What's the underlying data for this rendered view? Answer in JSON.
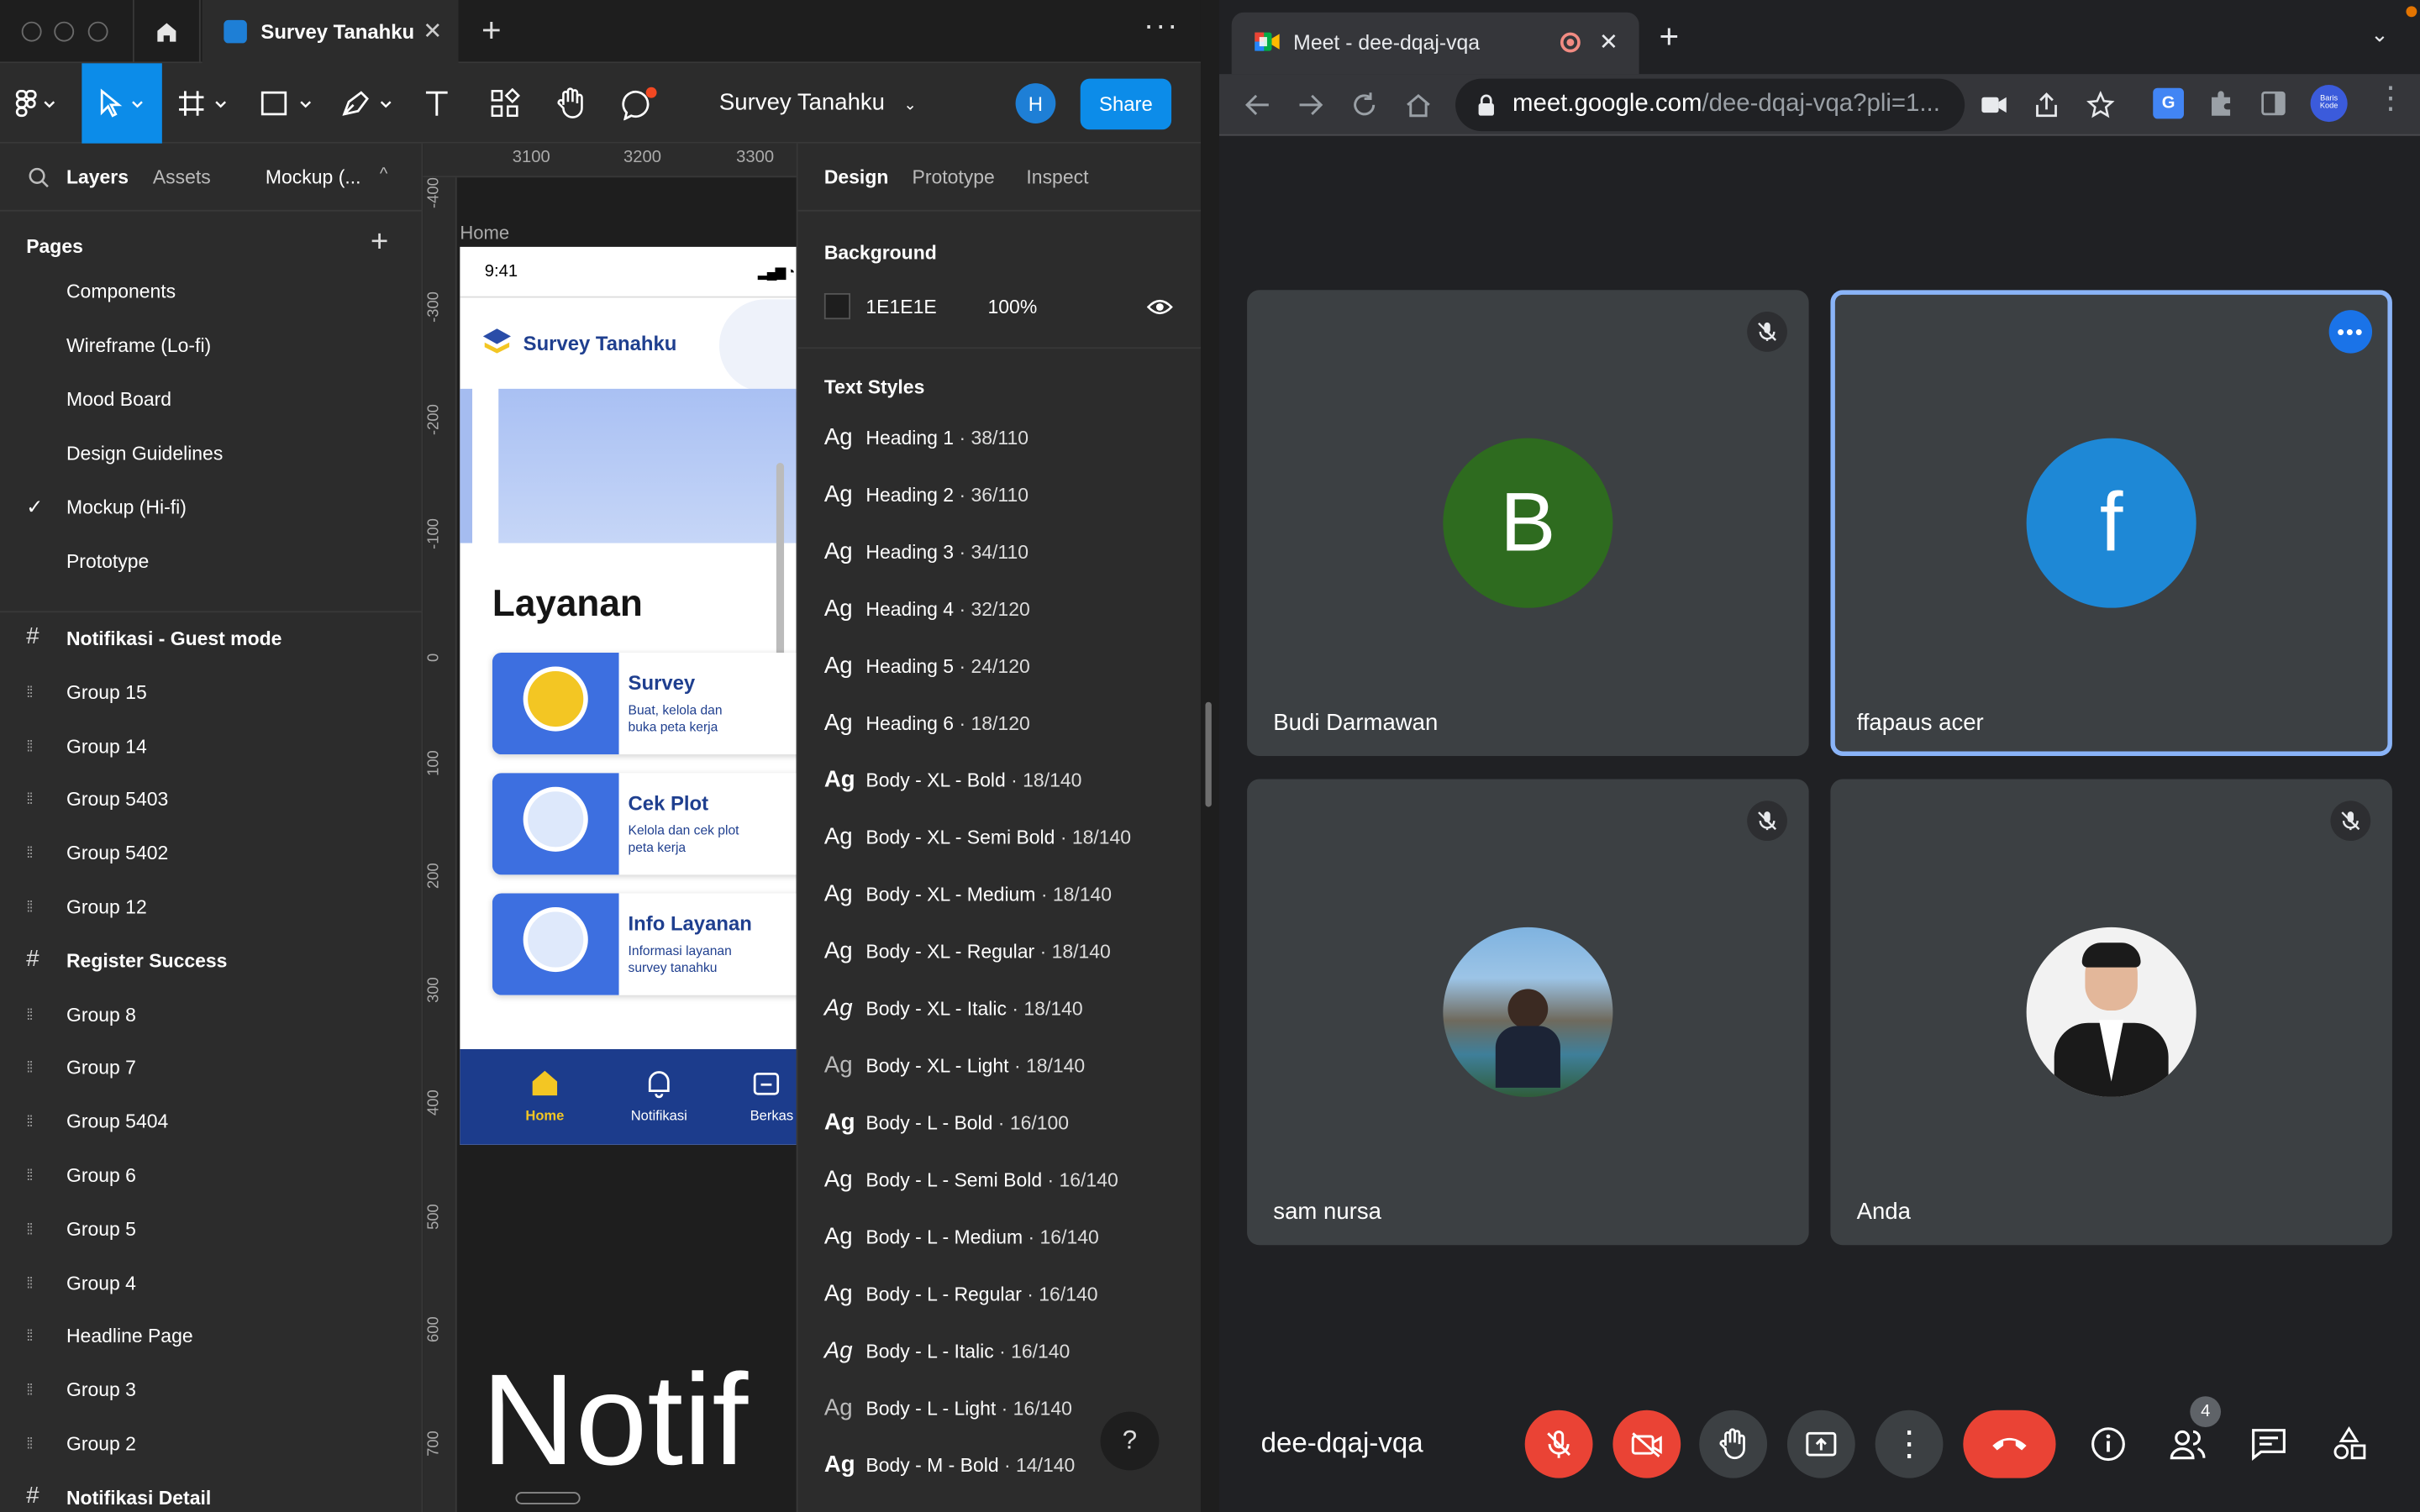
{
  "figma": {
    "tab_title": "Survey Tanahku",
    "file_title": "Survey Tanahku",
    "avatar_letter": "H",
    "share_label": "Share",
    "left_tabs": {
      "layers": "Layers",
      "assets": "Assets",
      "page": "Mockup (..."
    },
    "pages_header": "Pages",
    "pages": [
      {
        "label": "Components"
      },
      {
        "label": "Wireframe (Lo-fi)"
      },
      {
        "label": "Mood Board"
      },
      {
        "label": "Design Guidelines"
      },
      {
        "label": "Mockup (Hi-fi)",
        "selected": true
      },
      {
        "label": "Prototype"
      }
    ],
    "layers": [
      {
        "label": "Notifikasi - Guest mode",
        "kind": "frame"
      },
      {
        "label": "Group 15",
        "kind": "group"
      },
      {
        "label": "Group 14",
        "kind": "group"
      },
      {
        "label": "Group 5403",
        "kind": "group"
      },
      {
        "label": "Group 5402",
        "kind": "group"
      },
      {
        "label": "Group 12",
        "kind": "group"
      },
      {
        "label": "Register Success",
        "kind": "frame"
      },
      {
        "label": "Group 8",
        "kind": "group"
      },
      {
        "label": "Group 7",
        "kind": "group"
      },
      {
        "label": "Group 5404",
        "kind": "group"
      },
      {
        "label": "Group 6",
        "kind": "group"
      },
      {
        "label": "Group 5",
        "kind": "group"
      },
      {
        "label": "Group 4",
        "kind": "group"
      },
      {
        "label": "Headline Page",
        "kind": "group"
      },
      {
        "label": "Group 3",
        "kind": "group"
      },
      {
        "label": "Group 2",
        "kind": "group"
      },
      {
        "label": "Notifikasi Detail",
        "kind": "frame"
      }
    ],
    "ruler_top": [
      "3100",
      "3200",
      "3300"
    ],
    "ruler_left": [
      "-400",
      "-300",
      "-200",
      "-100",
      "0",
      "100",
      "200",
      "300",
      "400",
      "500",
      "600",
      "700"
    ],
    "canvas": {
      "frame_label": "Home",
      "status_time": "9:41",
      "app_name": "Survey Tanahku",
      "section_title": "Layanan",
      "cards": [
        {
          "title": "Survey",
          "desc": "Buat, kelola dan buka peta kerja"
        },
        {
          "title": "Cek Plot",
          "desc": "Kelola dan cek plot peta kerja"
        },
        {
          "title": "Info Layanan",
          "desc": "Informasi layanan survey tanahku"
        }
      ],
      "nav": [
        {
          "label": "Home"
        },
        {
          "label": "Notifikasi"
        },
        {
          "label": "Berkas"
        }
      ],
      "big_text": "Notif"
    },
    "right_tabs": {
      "design": "Design",
      "prototype": "Prototype",
      "inspect": "Inspect"
    },
    "background": {
      "title": "Background",
      "hex": "1E1E1E",
      "opacity": "100%",
      "color": "#1e1e1e"
    },
    "text_styles_title": "Text Styles",
    "text_styles": [
      {
        "name": "Heading 1",
        "spec": " · 38/110",
        "style": "normal",
        "weight": "normal"
      },
      {
        "name": "Heading 2",
        "spec": " · 36/110",
        "style": "normal",
        "weight": "normal"
      },
      {
        "name": "Heading 3",
        "spec": " · 34/110",
        "style": "normal",
        "weight": "normal"
      },
      {
        "name": "Heading 4",
        "spec": " · 32/120",
        "style": "normal",
        "weight": "normal"
      },
      {
        "name": "Heading 5",
        "spec": " · 24/120",
        "style": "normal",
        "weight": "normal"
      },
      {
        "name": "Heading 6",
        "spec": " · 18/120",
        "style": "normal",
        "weight": "normal"
      },
      {
        "name": "Body - XL - Bold",
        "spec": " · 18/140",
        "style": "normal",
        "weight": "bold"
      },
      {
        "name": "Body - XL - Semi Bold",
        "spec": " · 18/140",
        "style": "normal",
        "weight": "normal"
      },
      {
        "name": "Body - XL - Medium",
        "spec": " · 18/140",
        "style": "normal",
        "weight": "normal"
      },
      {
        "name": "Body - XL - Regular",
        "spec": " · 18/140",
        "style": "normal",
        "weight": "normal"
      },
      {
        "name": "Body - XL - Italic",
        "spec": " · 18/140",
        "style": "italic",
        "weight": "normal"
      },
      {
        "name": "Body - XL - Light",
        "spec": " · 18/140",
        "style": "normal",
        "weight": "light"
      },
      {
        "name": "Body - L - Bold",
        "spec": " · 16/100",
        "style": "normal",
        "weight": "bold"
      },
      {
        "name": "Body - L - Semi Bold",
        "spec": " · 16/140",
        "style": "normal",
        "weight": "normal"
      },
      {
        "name": "Body - L - Medium",
        "spec": " · 16/140",
        "style": "normal",
        "weight": "normal"
      },
      {
        "name": "Body - L - Regular",
        "spec": " · 16/140",
        "style": "normal",
        "weight": "normal"
      },
      {
        "name": "Body - L - Italic",
        "spec": " · 16/140",
        "style": "italic",
        "weight": "normal"
      },
      {
        "name": "Body - L - Light",
        "spec": " · 16/140",
        "style": "normal",
        "weight": "light"
      },
      {
        "name": "Body - M - Bold",
        "spec": " · 14/140",
        "style": "normal",
        "weight": "bold"
      }
    ],
    "glyph": "Ag",
    "help": "?"
  },
  "meet": {
    "tab_title": "Meet - dee-dqaj-vqa",
    "url_host": "meet.google.com",
    "url_path": "/dee-dqaj-vqa?pli=1...",
    "profile_label": "Baris Kode",
    "meeting_code": "dee-dqaj-vqa",
    "participant_count": "4",
    "participants": [
      {
        "name": "Budi Darmawan",
        "initial": "B",
        "color": "#2e6b1f",
        "muted": true,
        "pinned": false
      },
      {
        "name": "ffapaus acer",
        "initial": "f",
        "color": "#1e88d6",
        "muted": false,
        "pinned": true
      },
      {
        "name": "sam nursa",
        "initial": "",
        "color": "#5a8fb8",
        "muted": true,
        "pinned": false
      },
      {
        "name": "Anda",
        "initial": "",
        "color": "#f2f2f2",
        "muted": true,
        "pinned": false
      }
    ]
  }
}
